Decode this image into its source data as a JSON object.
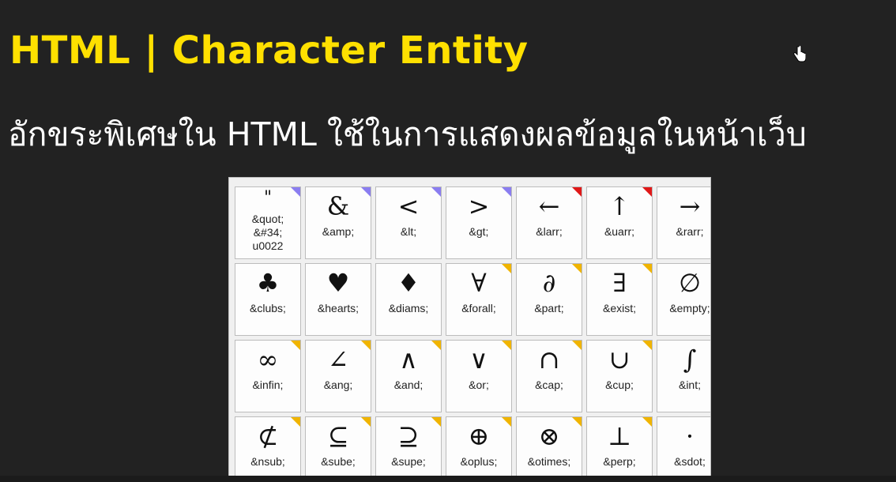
{
  "slide": {
    "title": "HTML | Character Entity",
    "subtitle": "อักขระพิเศษใน HTML ใช้ในการแสดงผลข้อมูลในหน้าเว็บ"
  },
  "colors": {
    "background": "#222222",
    "title": "#ffe000",
    "subtitle": "#ffffff",
    "corner_purple": "#8a7df0",
    "corner_red": "#e01818",
    "corner_yellow": "#f0b400"
  },
  "entities": [
    {
      "glyph": "\"",
      "code": "&quot;\n&#34;\nu0022",
      "corner": "purple"
    },
    {
      "glyph": "&",
      "code": "&amp;",
      "corner": "purple"
    },
    {
      "glyph": "<",
      "code": "&lt;",
      "corner": "purple"
    },
    {
      "glyph": ">",
      "code": "&gt;",
      "corner": "purple"
    },
    {
      "glyph": "←",
      "code": "&larr;",
      "corner": "red"
    },
    {
      "glyph": "↑",
      "code": "&uarr;",
      "corner": "red"
    },
    {
      "glyph": "→",
      "code": "&rarr;",
      "corner": ""
    },
    {
      "glyph": "♣",
      "code": "&clubs;",
      "corner": ""
    },
    {
      "glyph": "♥",
      "code": "&hearts;",
      "corner": ""
    },
    {
      "glyph": "♦",
      "code": "&diams;",
      "corner": ""
    },
    {
      "glyph": "∀",
      "code": "&forall;",
      "corner": "yellow"
    },
    {
      "glyph": "∂",
      "code": "&part;",
      "corner": "yellow"
    },
    {
      "glyph": "∃",
      "code": "&exist;",
      "corner": "yellow"
    },
    {
      "glyph": "∅",
      "code": "&empty;",
      "corner": ""
    },
    {
      "glyph": "∞",
      "code": "&infin;",
      "corner": "yellow"
    },
    {
      "glyph": "∠",
      "code": "&ang;",
      "corner": "yellow"
    },
    {
      "glyph": "∧",
      "code": "&and;",
      "corner": "yellow"
    },
    {
      "glyph": "∨",
      "code": "&or;",
      "corner": "yellow"
    },
    {
      "glyph": "∩",
      "code": "&cap;",
      "corner": "yellow"
    },
    {
      "glyph": "∪",
      "code": "&cup;",
      "corner": "yellow"
    },
    {
      "glyph": "∫",
      "code": "&int;",
      "corner": ""
    },
    {
      "glyph": "⊄",
      "code": "&nsub;",
      "corner": "yellow"
    },
    {
      "glyph": "⊆",
      "code": "&sube;",
      "corner": "yellow"
    },
    {
      "glyph": "⊇",
      "code": "&supe;",
      "corner": "yellow"
    },
    {
      "glyph": "⊕",
      "code": "&oplus;",
      "corner": "yellow"
    },
    {
      "glyph": "⊗",
      "code": "&otimes;",
      "corner": "yellow"
    },
    {
      "glyph": "⊥",
      "code": "&perp;",
      "corner": "yellow"
    },
    {
      "glyph": "⋅",
      "code": "&sdot;",
      "corner": ""
    }
  ]
}
